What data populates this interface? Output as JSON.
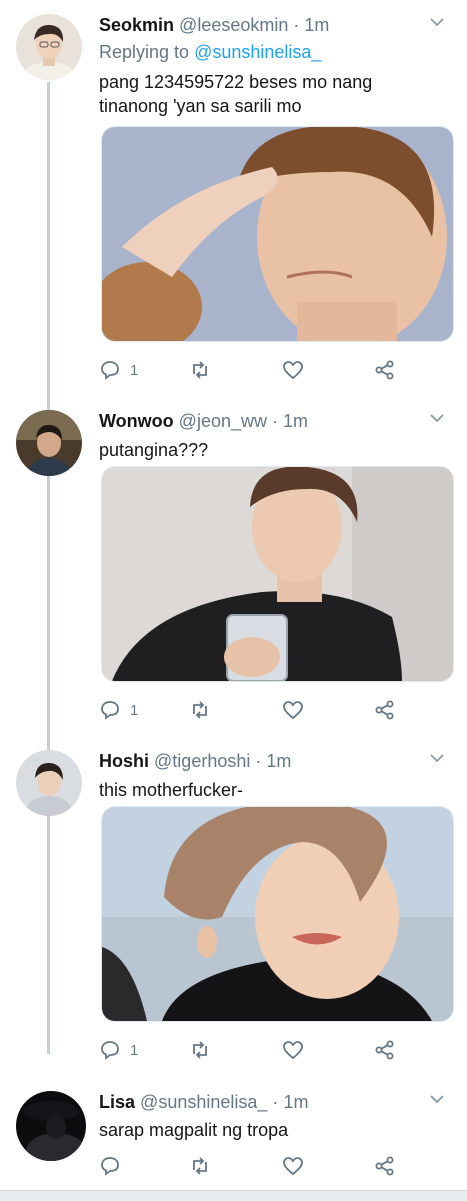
{
  "tweets": [
    {
      "name": "Seokmin",
      "handle": "@leeseokmin",
      "dot": "·",
      "time": "1m",
      "replying_prefix": "Replying to ",
      "replying_to": "@sunshinelisa_",
      "text": "pang 1234595722 beses mo nang\ntinanong 'yan sa sarili mo",
      "reply_count": "1"
    },
    {
      "name": "Wonwoo",
      "handle": "@jeon_ww",
      "dot": "·",
      "time": "1m",
      "text": "putangina???",
      "reply_count": "1"
    },
    {
      "name": "Hoshi",
      "handle": "@tigerhoshi",
      "dot": "·",
      "time": "1m",
      "text": "this motherfucker-",
      "reply_count": "1"
    },
    {
      "name": "Lisa",
      "handle": "@sunshinelisa_",
      "dot": "·",
      "time": "1m",
      "text": "sarap magpalit ng tropa",
      "reply_count": ""
    }
  ],
  "icons": {
    "reply": "speech-bubble-icon",
    "retweet": "retweet-arrows-icon",
    "like": "heart-icon",
    "share": "share-nodes-icon",
    "more": "chevron-down-icon"
  },
  "colors": {
    "link": "#1da1f2",
    "secondary_text": "#657786",
    "thread_line": "#c4cfd6"
  }
}
